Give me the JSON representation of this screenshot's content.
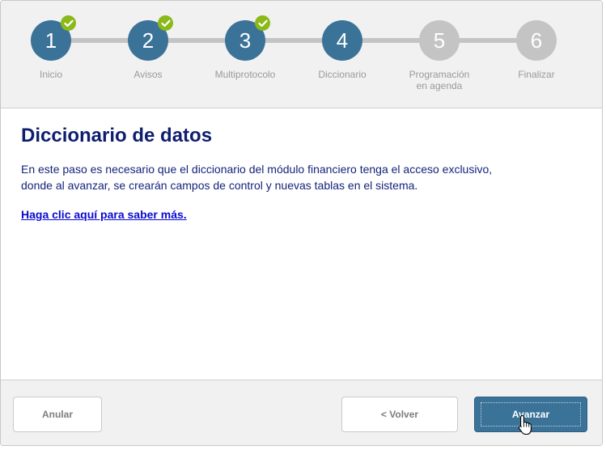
{
  "steps": [
    {
      "number": "1",
      "label": "Inicio",
      "state": "done"
    },
    {
      "number": "2",
      "label": "Avisos",
      "state": "done"
    },
    {
      "number": "3",
      "label": "Multiprotocolo",
      "state": "done"
    },
    {
      "number": "4",
      "label": "Diccionario",
      "state": "active"
    },
    {
      "number": "5",
      "label_line1": "Programación",
      "label_line2": "en agenda",
      "state": "pending"
    },
    {
      "number": "6",
      "label": "Finalizar",
      "state": "pending"
    }
  ],
  "content": {
    "title": "Diccionario de datos",
    "description_line1": "En este paso es necesario que el diccionario del módulo financiero tenga el acceso exclusivo,",
    "description_line2": "donde al avanzar, se crearán campos de control y nuevas tablas en el sistema.",
    "link_text": "Haga clic aquí para saber más. "
  },
  "footer": {
    "cancel_label": "Anular",
    "back_label": "< Volver",
    "next_label": "Avanzar"
  },
  "colors": {
    "step_done": "#3b7398",
    "step_pending": "#c4c4c4",
    "check_badge": "#8ab919",
    "title": "#0e1e6f",
    "link": "#0a0ad0",
    "primary_button": "#3b7398"
  },
  "icons": {
    "completed_badge": "check-icon",
    "pointer": "hand-cursor-icon"
  }
}
